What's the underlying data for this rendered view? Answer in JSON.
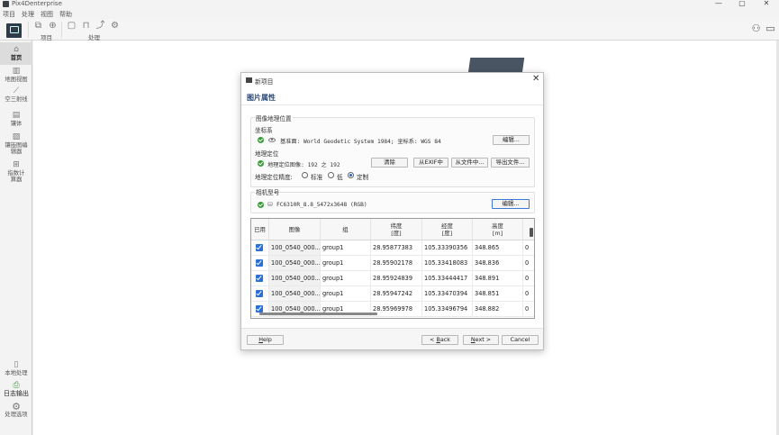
{
  "window": {
    "title": "Pix4Denterprise",
    "controls": {
      "minimize": "—",
      "maximize": "▢",
      "close": "✕"
    }
  },
  "menu": [
    "项目",
    "处理",
    "视图",
    "帮助"
  ],
  "toolbar": {
    "group_project": "项目",
    "group_process": "处理"
  },
  "sidebar": {
    "top": [
      {
        "label": "首页",
        "icon": "home-icon",
        "active": true
      },
      {
        "label": "地图视图",
        "icon": "map-view-icon"
      },
      {
        "label": "空三射线",
        "icon": "rays-icon"
      },
      {
        "label": "镶体",
        "icon": "mosaic-icon"
      },
      {
        "label": "镶嵌图编辑器",
        "icon": "mosaic-editor-icon"
      },
      {
        "label": "指数计算器",
        "icon": "index-calculator-icon"
      }
    ],
    "bottom": [
      {
        "label": "本地处理",
        "icon": "local-processing-icon"
      },
      {
        "label": "日志输出",
        "icon": "log-output-icon"
      },
      {
        "label": "处理选项",
        "icon": "gear-icon"
      }
    ]
  },
  "dialog": {
    "title": "新项目",
    "section_title": "图片属性",
    "geolocation": {
      "group_title": "图像地理位置",
      "coord_label": "坐标系",
      "coord_text": "基准面: World Geodetic System 1984; 坐标系: WGS 84",
      "edit1": "编辑...",
      "geoloc_label": "地理定位",
      "geoloc_text": "地理定位图像: 192 之 192",
      "btn_clear": "清除",
      "btn_from_exif": "从EXIF中",
      "btn_from_file": "从文件中...",
      "btn_export": "导出文件...",
      "accuracy_label": "地理定位精度:",
      "acc_standard": "标准",
      "acc_low": "低",
      "acc_custom": "定制"
    },
    "camera": {
      "group_title": "相机型号",
      "model_text": "FC6310R_8.8_5472x3648 (RGB)",
      "edit": "编辑..."
    },
    "table": {
      "headers": {
        "enabled": "已用",
        "image": "图像",
        "group": "组",
        "lat": [
          "纬度",
          "[度]"
        ],
        "lon": [
          "经度",
          "[度]"
        ],
        "alt": [
          "高度",
          "[m]"
        ]
      },
      "rows": [
        {
          "image": "100_0540_000...",
          "group": "group1",
          "lat": "28.95877383",
          "lon": "105.33390356",
          "alt": "348.865",
          "extra": "0"
        },
        {
          "image": "100_0540_000...",
          "group": "group1",
          "lat": "28.95902178",
          "lon": "105.33418083",
          "alt": "348.836",
          "extra": "0"
        },
        {
          "image": "100_0540_000...",
          "group": "group1",
          "lat": "28.95924839",
          "lon": "105.33444417",
          "alt": "348.891",
          "extra": "0"
        },
        {
          "image": "100_0540_000...",
          "group": "group1",
          "lat": "28.95947242",
          "lon": "105.33470394",
          "alt": "348.851",
          "extra": "0"
        },
        {
          "image": "100_0540_000...",
          "group": "group1",
          "lat": "28.95969978",
          "lon": "105.33496794",
          "alt": "348.882",
          "extra": "0"
        }
      ]
    },
    "footer": {
      "help_u": "H",
      "help_rest": "elp",
      "back_arrow": "<",
      "back_u": "B",
      "back_rest": "ack",
      "next_u": "N",
      "next_rest": "ext",
      "next_arrow": ">",
      "cancel": "Cancel"
    }
  }
}
